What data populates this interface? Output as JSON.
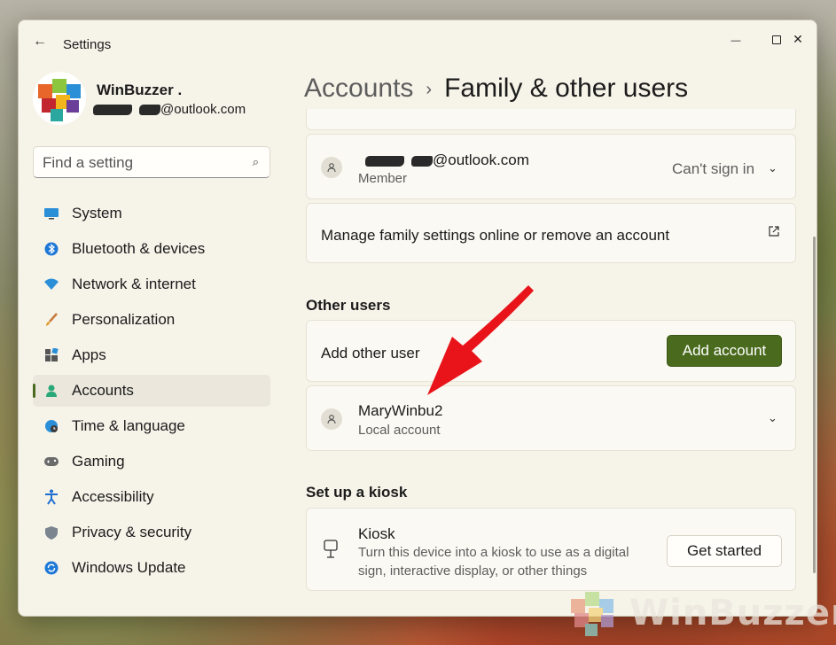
{
  "window": {
    "title": "Settings",
    "back_icon": "←",
    "minimize_icon": "—",
    "close_icon": "✕"
  },
  "profile": {
    "name": "WinBuzzer .",
    "email_suffix": "@outlook.com"
  },
  "search": {
    "placeholder": "Find a setting",
    "icon": "⌕"
  },
  "nav": {
    "items": [
      {
        "label": "System",
        "icon": "monitor-icon",
        "active": false
      },
      {
        "label": "Bluetooth & devices",
        "icon": "bluetooth-icon",
        "active": false
      },
      {
        "label": "Network & internet",
        "icon": "wifi-icon",
        "active": false
      },
      {
        "label": "Personalization",
        "icon": "brush-icon",
        "active": false
      },
      {
        "label": "Apps",
        "icon": "apps-icon",
        "active": false
      },
      {
        "label": "Accounts",
        "icon": "person-icon",
        "active": true
      },
      {
        "label": "Time & language",
        "icon": "globe-clock-icon",
        "active": false
      },
      {
        "label": "Gaming",
        "icon": "gamepad-icon",
        "active": false
      },
      {
        "label": "Accessibility",
        "icon": "accessibility-icon",
        "active": false
      },
      {
        "label": "Privacy & security",
        "icon": "shield-icon",
        "active": false
      },
      {
        "label": "Windows Update",
        "icon": "update-icon",
        "active": false
      }
    ]
  },
  "breadcrumb": {
    "parent": "Accounts",
    "separator": "›",
    "current": "Family & other users"
  },
  "family": {
    "member": {
      "email_suffix": "@outlook.com",
      "role": "Member",
      "status": "Can't sign in"
    },
    "manage_link": "Manage family settings online or remove an account"
  },
  "other_users": {
    "heading": "Other users",
    "add_label": "Add other user",
    "add_button": "Add account",
    "users": [
      {
        "name": "MaryWinbu2",
        "type": "Local account"
      }
    ]
  },
  "kiosk": {
    "heading": "Set up a kiosk",
    "title": "Kiosk",
    "description_line1": "Turn this device into a kiosk to use as a digital",
    "description_line2": "sign, interactive display, or other things",
    "button": "Get started"
  },
  "watermark": {
    "text": "WinBuzzer"
  },
  "colors": {
    "accent": "#4a6b1e",
    "window_bg": "#f6f3e9",
    "card_bg": "#fbf9f3",
    "arrow": "#e8141a"
  }
}
